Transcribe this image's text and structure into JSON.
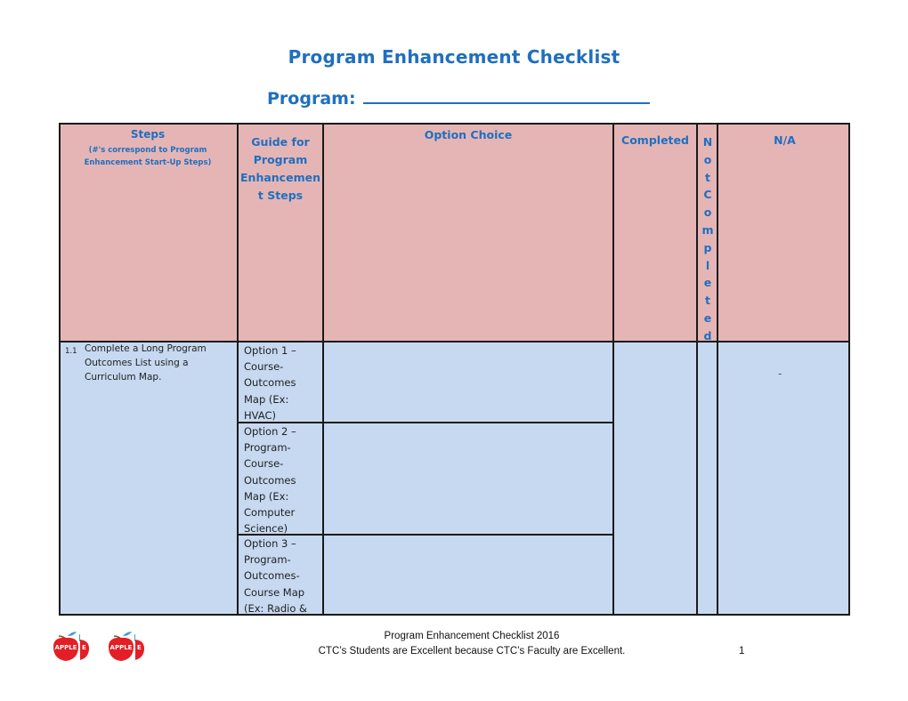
{
  "document": {
    "title": "Program Enhancement Checklist",
    "program_label": "Program:",
    "program_value": ""
  },
  "table": {
    "headers": {
      "steps": "Steps",
      "steps_note_line1": "(#'s correspond to Program",
      "steps_note_line2": "Enhancement Start-Up Steps)",
      "guide": [
        "Guide for",
        "Program",
        "Enhancemen",
        "t Steps"
      ],
      "option_choice": "Option Choice",
      "completed": "Completed",
      "not_completed_letters": [
        "N",
        "o",
        "t",
        "C",
        "o",
        "m",
        "p",
        "l",
        "e",
        "t",
        "e",
        "d"
      ],
      "na": "N/A"
    },
    "rows": [
      {
        "step_number": "1.1",
        "step_lines": [
          "Complete a Long Program",
          "Outcomes List using a",
          "Curriculum Map."
        ],
        "options": [
          {
            "lines": [
              "Option 1 –",
              "Course-",
              "Outcomes",
              "Map (Ex:",
              "HVAC)"
            ],
            "choice": ""
          },
          {
            "lines": [
              "Option 2 –",
              "Program-",
              "Course-",
              "Outcomes",
              "Map (Ex:",
              "Computer",
              "Science)"
            ],
            "choice": ""
          },
          {
            "lines": [
              "Option 3 –",
              "Program-",
              "Outcomes-",
              "Course Map",
              "(Ex:  Radio &"
            ],
            "choice": ""
          }
        ],
        "completed": "",
        "not_completed": "",
        "na": "-"
      }
    ]
  },
  "colors": {
    "header_bg": "#e5b5b5",
    "body_bg": "#c6d9f0",
    "heading_text": "#1f6fc0"
  },
  "footer": {
    "logo_label": "APPLE",
    "line1": "Program Enhancement Checklist  2016",
    "line2": "CTC’s Students are Excellent because CTC’s Faculty are Excellent.",
    "page_number": "1"
  }
}
